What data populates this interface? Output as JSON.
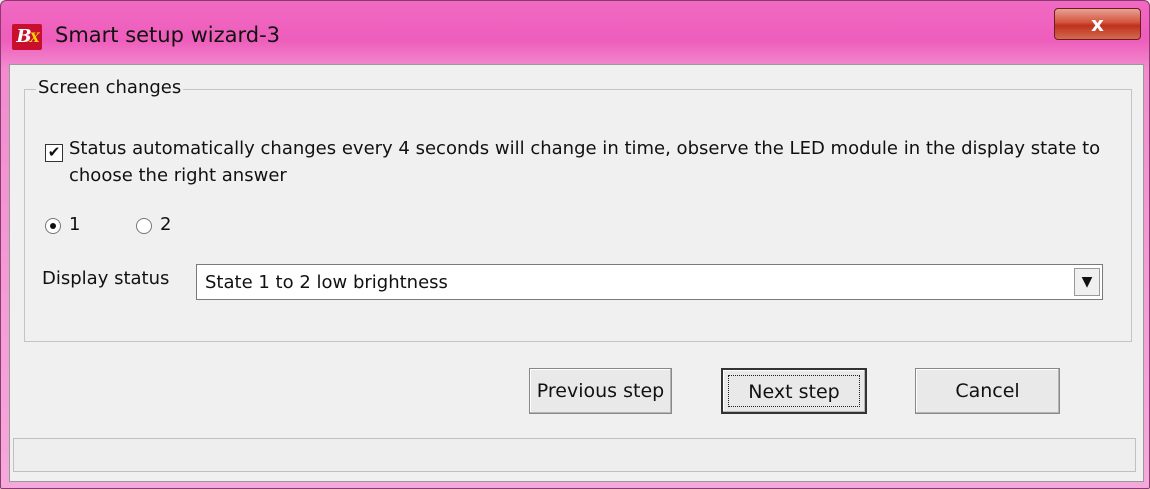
{
  "window": {
    "title": "Smart setup wizard-3",
    "close_label": "x",
    "icon_text_b": "B",
    "icon_text_x": "X"
  },
  "groupbox": {
    "legend": "Screen changes"
  },
  "auto_change": {
    "checked": true,
    "check_mark": "✔",
    "text": "Status automatically changes every 4 seconds will change in time, observe the LED module in the display state to choose the right answer"
  },
  "radios": [
    {
      "label": "1",
      "selected": true
    },
    {
      "label": "2",
      "selected": false
    }
  ],
  "display_status": {
    "label": "Display status",
    "value": "State 1 to 2 low brightness",
    "arrow": "▼"
  },
  "buttons": {
    "previous": "Previous step",
    "next": "Next step",
    "cancel": "Cancel"
  },
  "colors": {
    "titlebar": "#ee5dbb",
    "client": "#f0f0f0",
    "close": "#c0311a"
  }
}
